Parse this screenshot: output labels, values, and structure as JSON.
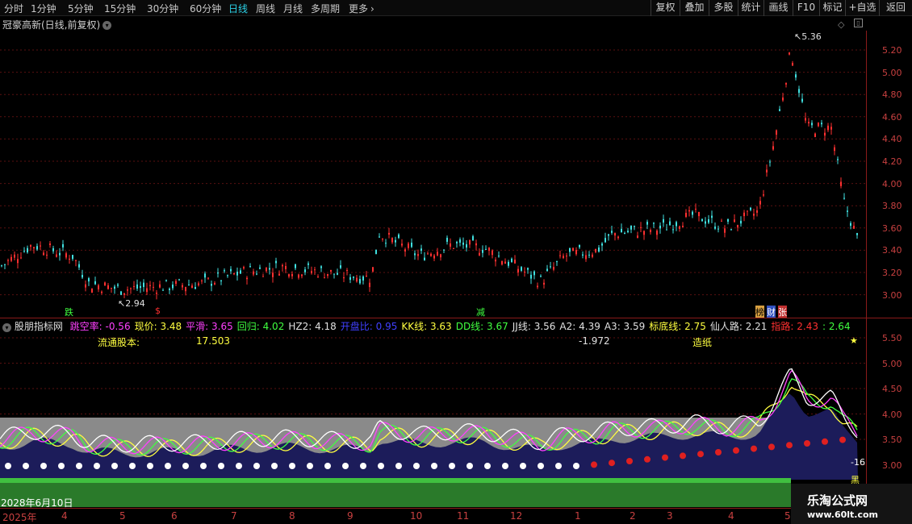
{
  "toolbar": {
    "periods": [
      "分时",
      "1分钟",
      "5分钟",
      "15分钟",
      "30分钟",
      "60分钟",
      "日线",
      "周线",
      "月线",
      "多周期",
      "更多"
    ],
    "active_period": "日线",
    "right_buttons": [
      "复权",
      "叠加",
      "多股",
      "统计",
      "画线",
      "F10",
      "标记",
      "+自选",
      "返回"
    ]
  },
  "main_chart": {
    "title": "冠豪高新(日线,前复权)",
    "price_labels": [
      "5.20",
      "5.00",
      "4.80",
      "4.60",
      "4.40",
      "4.20",
      "4.00",
      "3.80",
      "3.60",
      "3.40",
      "3.20",
      "3.00"
    ],
    "high_label": "5.36",
    "low_label": "2.94",
    "markers": [
      "跌",
      "$",
      "减",
      "榜",
      "财",
      "张"
    ]
  },
  "indicator": {
    "name": "股朋指标网",
    "fields": [
      {
        "label": "跳空率:",
        "value": "-0.56",
        "color": "#ff40ff"
      },
      {
        "label": "现价:",
        "value": "3.48",
        "color": "#ffff40"
      },
      {
        "label": "平滑:",
        "value": "3.65",
        "color": "#ff40ff"
      },
      {
        "label": "回归:",
        "value": "4.02",
        "color": "#40ff40"
      },
      {
        "label": "HZ2:",
        "value": "4.18",
        "color": "#e0e0e0"
      },
      {
        "label": "开盘比:",
        "value": "0.95",
        "color": "#4040ff"
      },
      {
        "label": "KK线:",
        "value": "3.63",
        "color": "#ffff40"
      },
      {
        "label": "DD线:",
        "value": "3.67",
        "color": "#40ff40"
      },
      {
        "label": "JJ线:",
        "value": "3.56",
        "color": "#e0e0e0"
      },
      {
        "label": "A2:",
        "value": "4.39",
        "color": "#e0e0e0"
      },
      {
        "label": "A3:",
        "value": "3.59",
        "color": "#e0e0e0"
      },
      {
        "label": "标底线:",
        "value": "2.75",
        "color": "#ffff40"
      },
      {
        "label": "仙人路:",
        "value": "2.21",
        "color": "#e0e0e0"
      },
      {
        "label": "指路:",
        "value": "2.43",
        "color": "#ff3030"
      },
      {
        "label": ":",
        "value": "2.64",
        "color": "#40ff40"
      }
    ],
    "row2": {
      "label1": "流通股本:",
      "value1": "17.503",
      "value2": "-1.972",
      "label3": "造纸"
    },
    "y_labels": [
      "5.50",
      "5.00",
      "4.50",
      "4.00",
      "3.50",
      "3.00"
    ],
    "last_value": "-16",
    "tag": "黑"
  },
  "x_axis": {
    "labels": [
      "2025年",
      "4",
      "5",
      "6",
      "7",
      "8",
      "9",
      "10",
      "11",
      "12",
      "1",
      "2",
      "3",
      "4",
      "5"
    ],
    "date_tooltip": "2028年6月10日"
  },
  "watermark": {
    "name": "乐淘公式网",
    "url": "www.60lt.com"
  }
}
